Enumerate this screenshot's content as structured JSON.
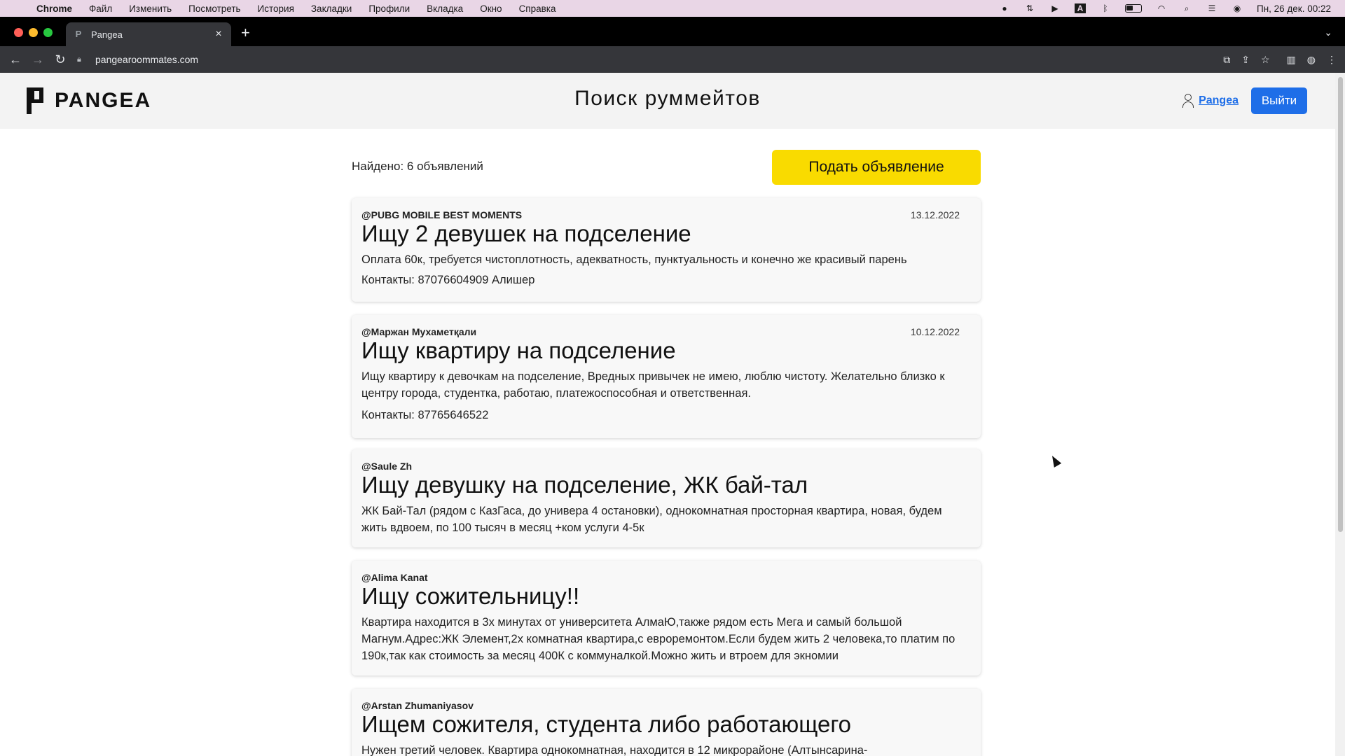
{
  "menubar": {
    "app": "Chrome",
    "items": [
      "Файл",
      "Изменить",
      "Посмотреть",
      "История",
      "Закладки",
      "Профили",
      "Вкладка",
      "Окно",
      "Справка"
    ],
    "datetime": "Пн, 26 дек.  00:22",
    "keyboard_layout": "A"
  },
  "browser": {
    "tab_title": "Pangea",
    "tab_favicon": "P",
    "url": "pangearoommates.com"
  },
  "site": {
    "logo_text": "PANGEA",
    "page_title": "Поиск руммейтов",
    "user_link": "Pangea",
    "logout_label": "Выйти",
    "found_text": "Найдено: 6 объявлений",
    "post_button": "Подать объявление"
  },
  "listings": [
    {
      "author": "@PUBG MOBILE BEST MOMENTS",
      "date": "13.12.2022",
      "title": "Ищу 2 девушек на подселение",
      "description": "Оплата 60к, требуется чистоплотность, адекватность, пунктуальность и конечно же красивый парень",
      "contact": "Контакты: 87076604909 Алишер"
    },
    {
      "author": "@Маржан Мухаметқали",
      "date": "10.12.2022",
      "title": "Ищу квартиру на подселение",
      "description": "Ищу квартиру к девочкам на подселение, Вредных привычек не имею, люблю чистоту. Желательно близко к центру города, студентка, работаю, платежоспособная и ответственная.",
      "contact": "Контакты: 87765646522"
    },
    {
      "author": "@Saule Zh",
      "date": "",
      "title": "Ищу девушку на подселение, ЖК бай-тал",
      "description": "ЖК Бай-Тал (рядом с КазГаса, до универа 4 остановки), однокомнатная просторная квартира, новая, будем жить вдвоем, по 100 тысяч в месяц +ком услуги 4-5к",
      "contact": ""
    },
    {
      "author": "@Alima Kanat",
      "date": "",
      "title": "Ищу сожительницу!!",
      "description": "Квартира находится в 3х минутах от университета АлмаЮ,также рядом есть Мега и самый большой Магнум.Адрес:ЖК Элемент,2х комнатная квартира,с евроремонтом.Если будем жить 2 человека,то платим по 190к,так как стоимость за месяц 400К с коммуналкой.Можно жить и втроем для экномии",
      "contact": ""
    },
    {
      "author": "@Arstan Zhumaniyasov",
      "date": "",
      "title": "Ищем сожителя, студента либо работающего",
      "description": "Нужен третий человек. Квартира однокомнатная, находится в 12 микрорайоне (Алтынсарина-",
      "contact": ""
    }
  ],
  "colors": {
    "menubar_bg": "#e9d6e6",
    "accent_blue": "#1e6ee8",
    "post_button_yellow": "#f9db00",
    "header_bg": "#f3f3f3"
  }
}
